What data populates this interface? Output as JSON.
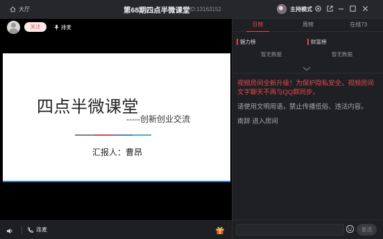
{
  "titlebar": {
    "lobby_label": "大厅",
    "title": "第68期四点半微课堂",
    "room_id": "ID:13163152",
    "host_mode_label": "主持模式",
    "icons": [
      "home-icon",
      "settings-icon",
      "popout-icon",
      "minimize-icon",
      "maximize-icon",
      "close-icon"
    ]
  },
  "video": {
    "follow_label": "关注",
    "mic_queue_label": "排麦",
    "slide": {
      "title": "四点半微课堂",
      "subtitle": "-----创新创业交流",
      "reporter": "汇报人：曹昂",
      "line_colors": [
        "#7f7f7f",
        "#c0504d",
        "#4f81bd",
        "#4bacc6"
      ]
    }
  },
  "bottombar": {
    "connect_label": "连麦",
    "icons": [
      "volume-icon",
      "phone-icon",
      "gift-icon"
    ]
  },
  "panel": {
    "tabs": [
      {
        "label": "日榜",
        "active": true
      },
      {
        "label": "周榜",
        "active": false
      },
      {
        "label": "在线73",
        "active": false
      }
    ],
    "charm_rank": {
      "title": "魅力榜",
      "empty": "暂无数据"
    },
    "wealth_rank": {
      "title": "财富榜",
      "empty": "暂无数据"
    },
    "messages": {
      "notice": "视频房间全新升级！为保护隐私安全，视频房间文字聊天不再与QQ群同步。",
      "rule": "请使用文明用语，禁止传播低俗、违法内容。",
      "join": "南辞  进入房间"
    },
    "composer": {
      "placeholder": "",
      "send_label": "发送"
    }
  },
  "colors": {
    "accent": "#e6484a",
    "background": "#1b1c20",
    "panel": "#1f2024"
  }
}
